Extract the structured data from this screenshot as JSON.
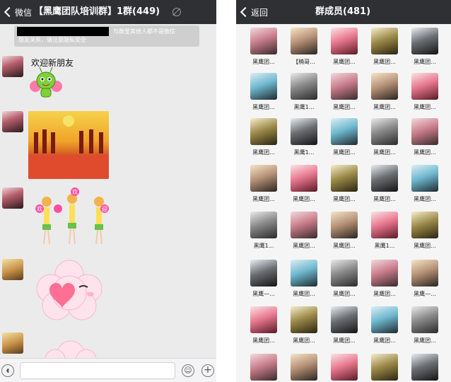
{
  "chat": {
    "back_label": "微信",
    "title": "【黑鹰团队培训群】1群(449)",
    "notice_line1": "与群里其他人都不是微信",
    "notice_line2": "朋友关系，请注意隐私安全",
    "welcome_text": "欢迎新朋友",
    "sticker_words": [
      "欢",
      "欢",
      "迎"
    ]
  },
  "members": {
    "back_label": "返回",
    "title": "群成员(481)",
    "names": [
      [
        "黑鹰团...",
        "【楠哥...",
        "黑鹰团...",
        "黑鹰团...",
        "黑鹰团..."
      ],
      [
        "黑鹰团...",
        "黑鹰1...",
        "黑鹰团...",
        "黑鹰团...",
        "黑鹰团..."
      ],
      [
        "黑鹰团...",
        "黑鹰1...",
        "黑鹰团...",
        "黑鹰团...",
        "黑鹰团..."
      ],
      [
        "黑鹰团...",
        "黑鹰团...",
        "黑鹰团...",
        "黑鹰团...",
        "黑鹰团..."
      ],
      [
        "黑鹰1...",
        "黑鹰团...",
        "黑鹰团...",
        "黑鹰1...",
        "黑鹰团..."
      ],
      [
        "黑鹰—...",
        "黑鹰团...",
        "黑鹰团...",
        "黑鹰团...",
        "黑鹰—..."
      ],
      [
        "黑鹰团...",
        "黑鹰团...",
        "黑鹰团...",
        "黑鹰团...",
        "黑鹰团..."
      ],
      [
        "",
        "",
        "",
        "",
        ""
      ]
    ]
  },
  "colors": {
    "nav_bar": "#2f3033",
    "chat_bg": "#ebebeb",
    "members_bg": "#f5f5f5"
  }
}
